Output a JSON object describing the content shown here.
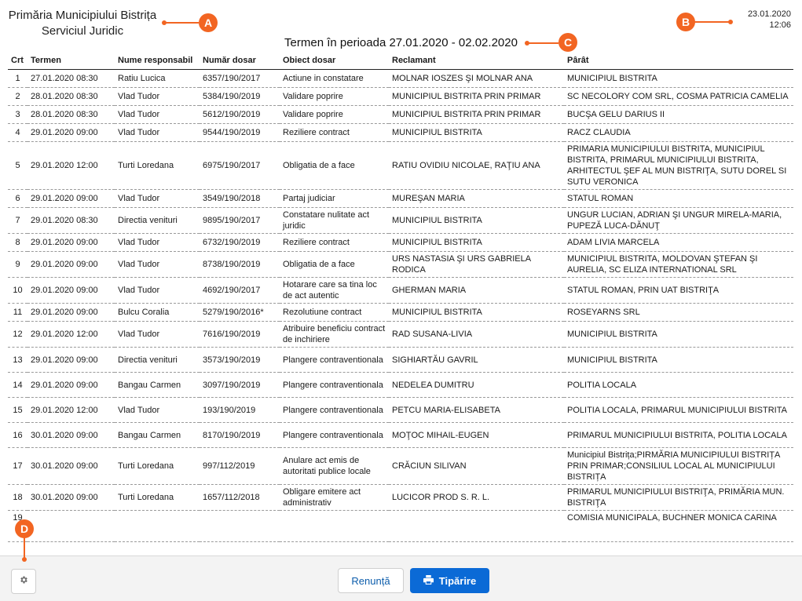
{
  "header": {
    "org_line1": "Primăria Municipiului Bistrița",
    "org_line2": "Serviciul Juridic",
    "date": "23.01.2020",
    "time": "12:06",
    "period": "Termen în perioada 27.01.2020 - 02.02.2020"
  },
  "table": {
    "columns": [
      "Crt",
      "Termen",
      "Nume responsabil",
      "Număr dosar",
      "Obiect dosar",
      "Reclamant",
      "Pârât"
    ],
    "rows": [
      [
        "1",
        "27.01.2020 08:30",
        "Ratiu Lucica",
        "6357/190/2017",
        "Actiune in constatare",
        "MOLNAR IOSZES ŞI MOLNAR ANA",
        "MUNICIPIUL BISTRITA"
      ],
      [
        "2",
        "28.01.2020 08:30",
        "Vlad Tudor",
        "5384/190/2019",
        "Validare poprire",
        "MUNICIPIUL BISTRITA PRIN PRIMAR",
        "SC NECOLORY COM SRL, COSMA PATRICIA CAMELIA"
      ],
      [
        "3",
        "28.01.2020 08:30",
        "Vlad Tudor",
        "5612/190/2019",
        "Validare poprire",
        "MUNICIPIUL BISTRITA PRIN PRIMAR",
        "BUCŞA GELU DARIUS II"
      ],
      [
        "4",
        "29.01.2020 09:00",
        "Vlad Tudor",
        "9544/190/2019",
        "Reziliere contract",
        "MUNICIPIUL BISTRITA",
        "RACZ CLAUDIA"
      ],
      [
        "5",
        "29.01.2020 12:00",
        "Turti Loredana",
        "6975/190/2017",
        "Obligatia de a face",
        "RATIU OVIDIU NICOLAE, RAŢIU ANA",
        "PRIMARIA MUNICIPIULUI BISTRITA, MUNICIPIUL BISTRITA, PRIMARUL MUNICIPIULUI BISTRITA, ARHITECTUL ŞEF AL MUN BISTRIŢA, SUTU DOREL SI SUTU VERONICA"
      ],
      [
        "6",
        "29.01.2020 09:00",
        "Vlad Tudor",
        "3549/190/2018",
        "Partaj judiciar",
        "MUREŞAN MARIA",
        "STATUL ROMAN"
      ],
      [
        "7",
        "29.01.2020 08:30",
        "Directia venituri",
        "9895/190/2017",
        "Constatare nulitate act juridic",
        "MUNICIPIUL BISTRITA",
        "UNGUR LUCIAN, ADRIAN ŞI UNGUR MIRELA-MARIA, PUPEZĂ LUCA-DĂNUŢ"
      ],
      [
        "8",
        "29.01.2020 09:00",
        "Vlad Tudor",
        "6732/190/2019",
        "Reziliere contract",
        "MUNICIPIUL BISTRITA",
        "ADAM LIVIA MARCELA"
      ],
      [
        "9",
        "29.01.2020 09:00",
        "Vlad Tudor",
        "8738/190/2019",
        "Obligatia de a face",
        "URS NASTASIA ŞI URS GABRIELA RODICA",
        "MUNICIPIUL BISTRITA, MOLDOVAN ŞTEFAN ŞI AURELIA, SC ELIZA INTERNATIONAL SRL"
      ],
      [
        "10",
        "29.01.2020 09:00",
        "Vlad Tudor",
        "4692/190/2017",
        "Hotarare care sa tina loc de act autentic",
        "GHERMAN MARIA",
        "STATUL ROMAN, PRIN UAT BISTRIŢA"
      ],
      [
        "11",
        "29.01.2020 09:00",
        "Bulcu Coralia",
        "5279/190/2016*",
        "Rezolutiune contract",
        "MUNICIPIUL BISTRITA",
        "ROSEYARNS SRL"
      ],
      [
        "12",
        "29.01.2020 12:00",
        "Vlad Tudor",
        "7616/190/2019",
        "Atribuire beneficiu contract de inchiriere",
        "RAD SUSANA-LIVIA",
        "MUNICIPIUL BISTRITA"
      ],
      [
        "13",
        "29.01.2020 09:00",
        "Directia venituri",
        "3573/190/2019",
        "Plangere contraventionala",
        "SIGHIARTĂU GAVRIL",
        "MUNICIPIUL BISTRITA"
      ],
      [
        "14",
        "29.01.2020 09:00",
        "Bangau Carmen",
        "3097/190/2019",
        "Plangere contraventionala",
        "NEDELEA DUMITRU",
        "POLITIA LOCALA"
      ],
      [
        "15",
        "29.01.2020 12:00",
        "Vlad Tudor",
        "193/190/2019",
        "Plangere contraventionala",
        "PETCU MARIA-ELISABETA",
        "POLITIA LOCALA, PRIMARUL MUNICIPIULUI BISTRITA"
      ],
      [
        "16",
        "30.01.2020 09:00",
        "Bangau Carmen",
        "8170/190/2019",
        "Plangere contraventionala",
        "MOŢOC MIHAIL-EUGEN",
        "PRIMARUL MUNICIPIULUI BISTRITA, POLITIA LOCALA"
      ],
      [
        "17",
        "30.01.2020 09:00",
        "Turti Loredana",
        "997/112/2019",
        "Anulare act emis de autoritati publice locale",
        "CRĂCIUN SILIVAN",
        "Municipiul Bistrița;PIRMĂRIA MUNICIPIULUI BISTRIȚA PRIN PRIMAR;CONSILIUL LOCAL AL MUNICIPIULUI BISTRIȚA"
      ],
      [
        "18",
        "30.01.2020 09:00",
        "Turti Loredana",
        "1657/112/2018",
        "Obligare emitere act administrativ",
        "LUCICOR PROD S. R. L.",
        "PRIMARUL MUNICIPIULUI BISTRIŢA, PRIMĂRIA MUN. BISTRIŢA"
      ],
      [
        "19",
        "",
        "",
        "",
        "",
        "",
        "COMISIA MUNICIPALA, BUCHNER MONICA CARINA"
      ]
    ]
  },
  "footer": {
    "cancel_label": "Renunță",
    "print_label": "Tipărire"
  },
  "markers": [
    "A",
    "B",
    "C",
    "D"
  ],
  "colors": {
    "marker": "#f26522",
    "primary_button": "#0b6ad6",
    "link": "#0b5cab"
  }
}
